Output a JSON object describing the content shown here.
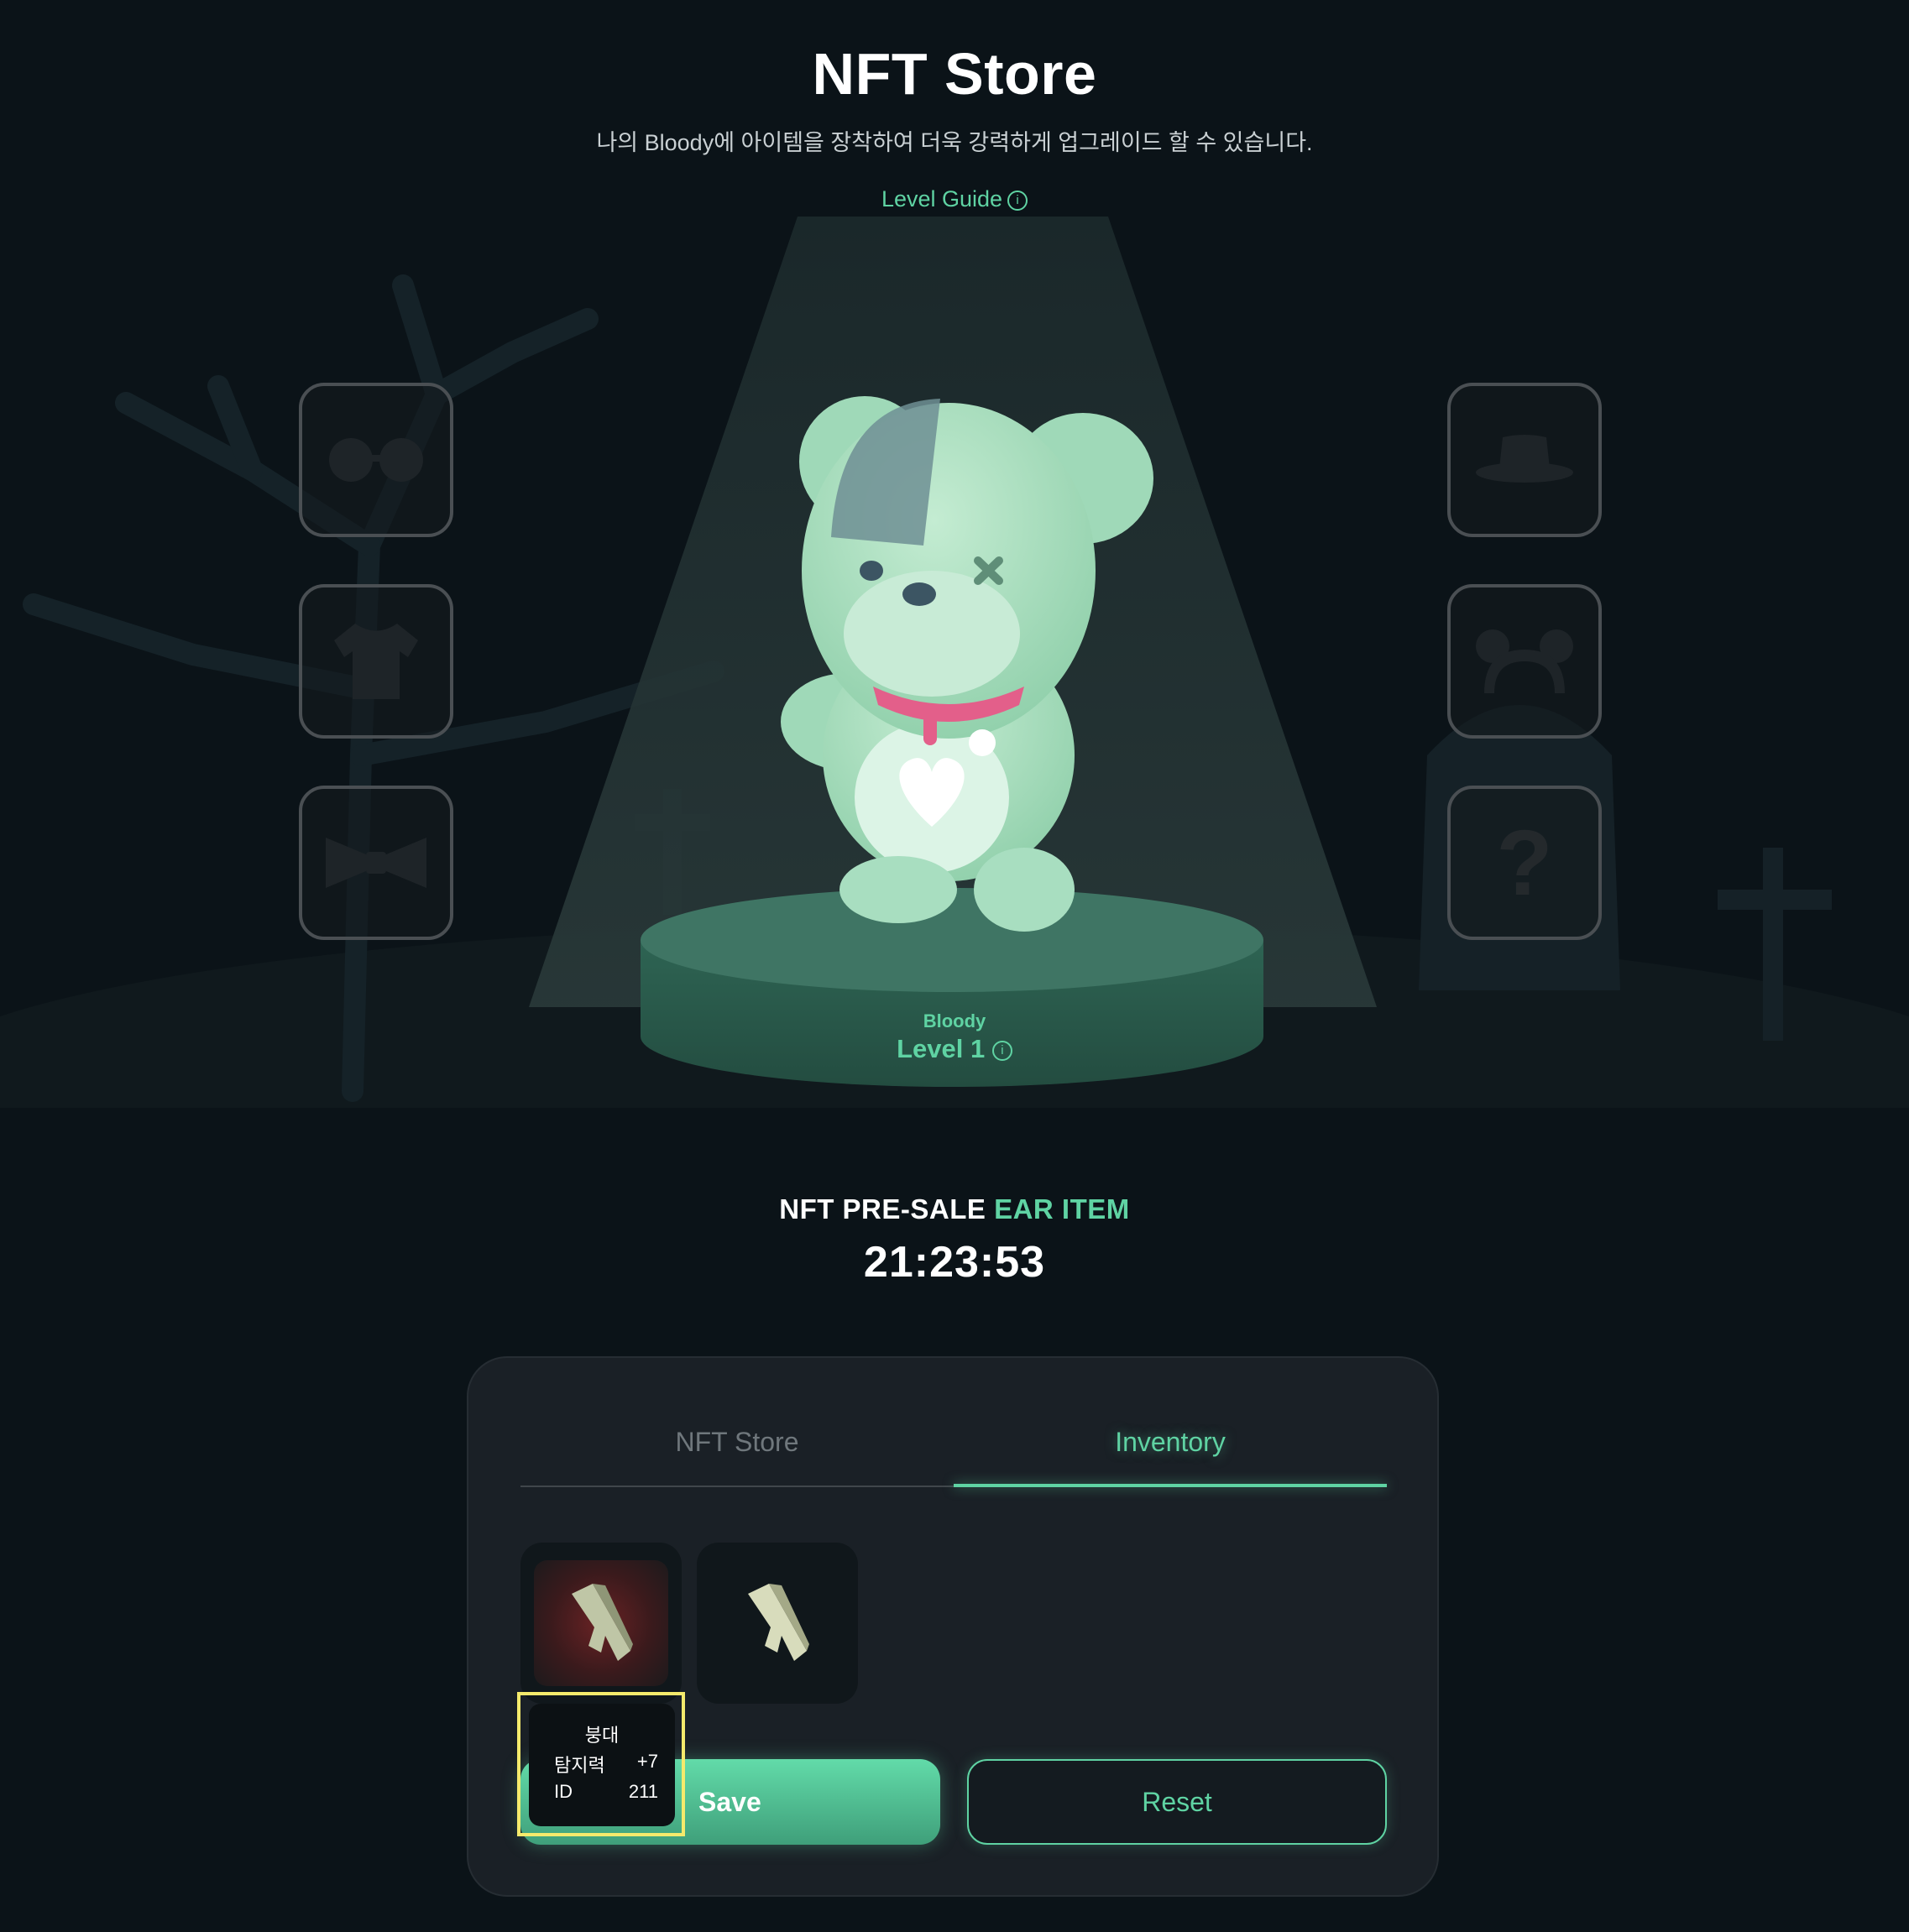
{
  "header": {
    "title": "NFT Store",
    "subtitle": "나의 Bloody에 아이템을 장착하여 더욱 강력하게 업그레이드 할 수 있습니다.",
    "level_guide": "Level Guide",
    "info_glyph": "i"
  },
  "character": {
    "name": "Bloody",
    "level": "Level 1"
  },
  "slots": {
    "left": [
      "glasses-icon",
      "shirt-icon",
      "bowtie-icon"
    ],
    "right": [
      "hat-icon",
      "ear-headband-icon",
      "question-icon"
    ],
    "question_glyph": "?"
  },
  "presale": {
    "prefix": "NFT PRE-SALE",
    "accent": "EAR ITEM",
    "timer": "21:23:53"
  },
  "panel": {
    "tabs": [
      {
        "label": "NFT Store",
        "active": false
      },
      {
        "label": "Inventory",
        "active": true
      }
    ],
    "items": [
      "bandage-icon",
      "bandage-icon"
    ],
    "save_label": "Save",
    "reset_label": "Reset"
  },
  "tooltip": {
    "name": "붕대",
    "stat_label": "탐지력",
    "stat_value": "+7",
    "id_label": "ID",
    "id_value": "211"
  },
  "colors": {
    "background": "#0b1318",
    "accent": "#5fd3a3",
    "panel": "#1a2026",
    "highlight": "#f5ea6c"
  }
}
